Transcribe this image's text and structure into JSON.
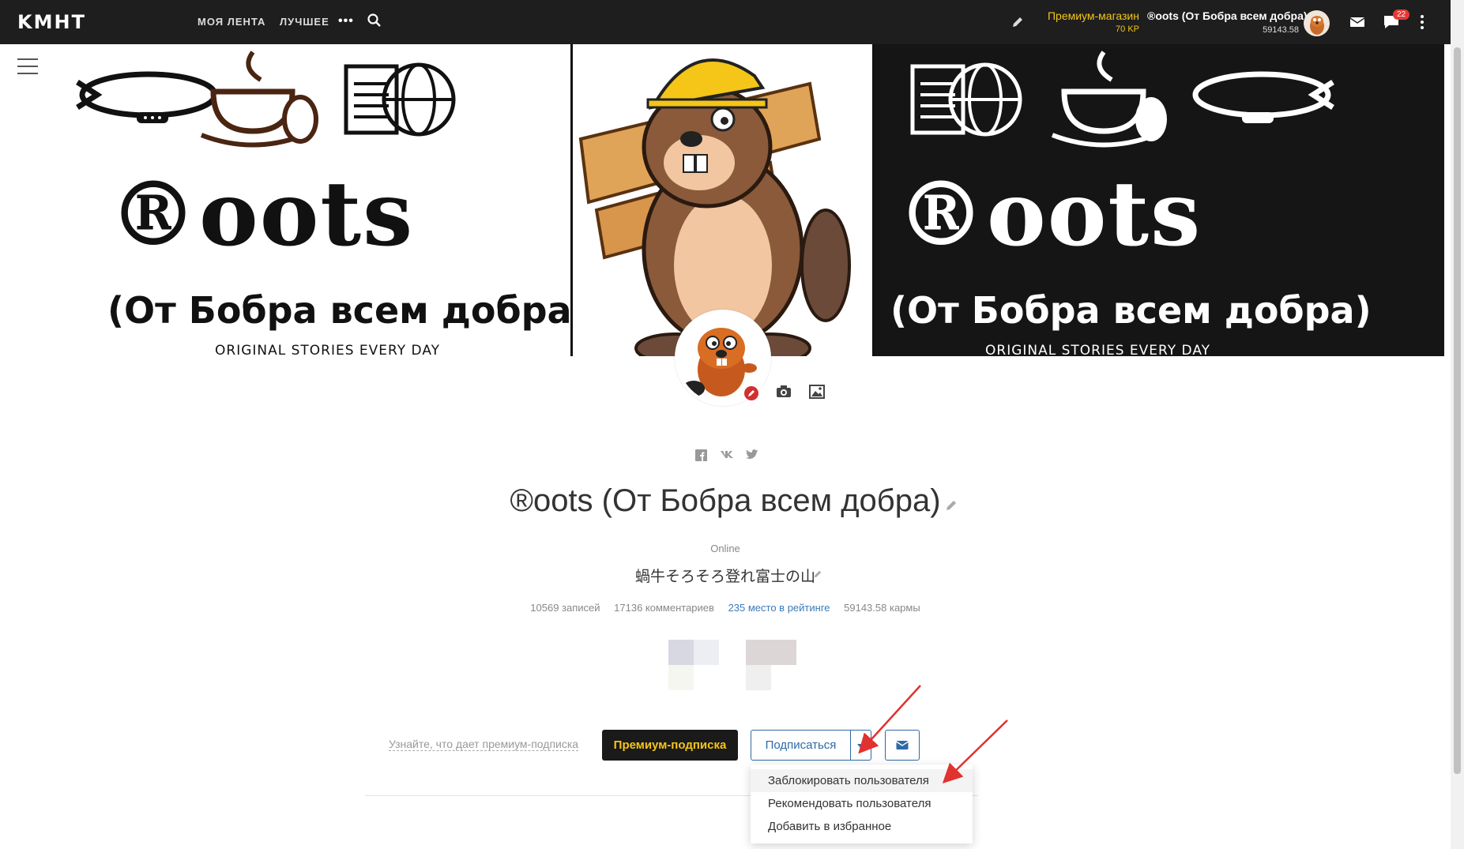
{
  "topbar": {
    "logo": "KMHT",
    "nav": {
      "feed": "МОЯ ЛЕНТА",
      "best": "ЛУЧШЕЕ",
      "more": "•••"
    },
    "premium_shop": {
      "label": "Премиум-магазин",
      "kp": "70 KP"
    },
    "user": {
      "name": "®oots (От Бобра всем добра)",
      "karma": "59143.58"
    },
    "notifications_count": "22",
    "accent_color": "#f5c518"
  },
  "cover": {
    "left": {
      "title": "®oots",
      "subtitle": "(От Бобра всем добра)",
      "tagline": "ORIGINAL STORIES EVERY DAY"
    },
    "right": {
      "title": "®oots",
      "subtitle": "(От Бобра всем добра)",
      "tagline": "ORIGINAL STORIES EVERY DAY"
    }
  },
  "profile": {
    "name": "®oots (От Бобра всем добра)",
    "status": "Online",
    "motto": "蝸牛そろそろ登れ富士の山",
    "stats": {
      "posts": "10569 записей",
      "comments": "17136 комментариев",
      "rank": "235 место в рейтинге",
      "karma": "59143.58 кармы"
    }
  },
  "actions": {
    "learn_premium": "Узнайте, что дает премиум-подписка",
    "premium_button": "Премиум-подписка",
    "subscribe_button": "Подписаться"
  },
  "dropdown": {
    "items": [
      "Заблокировать пользователя",
      "Рекомендовать пользователя",
      "Добавить в избранное"
    ]
  },
  "icons": {
    "search": "search-icon",
    "pencil": "pencil-icon",
    "mail": "mail-icon",
    "chat": "chat-icon",
    "kebab": "kebab-menu-icon",
    "camera": "camera-icon",
    "image": "image-icon",
    "facebook": "facebook-icon",
    "vk": "vk-icon",
    "twitter": "twitter-icon"
  }
}
